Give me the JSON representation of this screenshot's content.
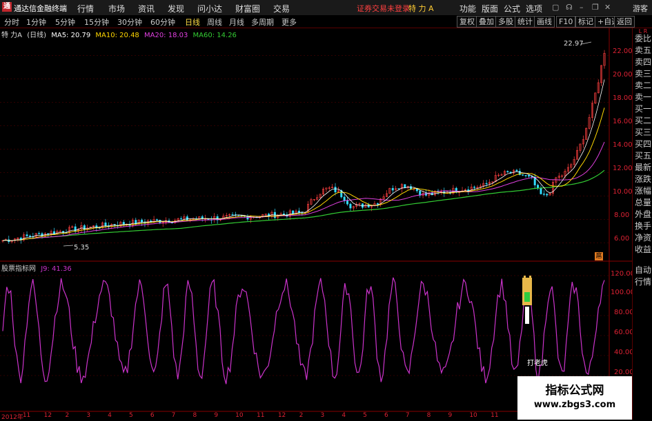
{
  "app": {
    "name": "通达信金融终端",
    "logo_text": "通"
  },
  "menu": [
    "行情",
    "市场",
    "资讯",
    "发现",
    "问小达",
    "财富圈",
    "交易"
  ],
  "login_status": "证券交易未登录",
  "stock_title": "特 力 A",
  "right_menu": [
    "功能",
    "版面",
    "公式",
    "选项"
  ],
  "guest": "游客",
  "period_tabs": [
    "分时",
    "1分钟",
    "5分钟",
    "15分钟",
    "30分钟",
    "60分钟",
    "日线",
    "周线",
    "月线",
    "多周期",
    "更多"
  ],
  "active_tab": "日线",
  "toolbar_buttons": [
    "复权",
    "叠加",
    "多股",
    "统计",
    "画线",
    "F10",
    "标记",
    "+自选",
    "返回"
  ],
  "main_chart": {
    "stock_label": "特 力A",
    "period_label": "(日线)",
    "ma": [
      {
        "label": "MA5: 20.79",
        "color": "#ffffff"
      },
      {
        "label": "MA10: 20.48",
        "color": "#ffd700"
      },
      {
        "label": "MA20: 18.03",
        "color": "#e040e0"
      },
      {
        "label": "MA60: 14.26",
        "color": "#33cc33"
      }
    ],
    "y_ticks": [
      "22.00",
      "20.00",
      "18.00",
      "16.00",
      "14.00",
      "12.00",
      "10.00",
      "8.00",
      "6.00"
    ],
    "high_label": "22.97",
    "low_label": "5.35",
    "badge": "扈"
  },
  "indicator": {
    "name": "股票指标网",
    "value_label": "J9: 41.36",
    "y_ticks": [
      "120.00",
      "100.00",
      "80.00",
      "60.00",
      "40.00",
      "20.00"
    ],
    "signal_label": "打老虎"
  },
  "right_panel": {
    "corner": "L R",
    "items": [
      "委比",
      "卖五",
      "卖四",
      "卖三",
      "卖二",
      "卖一",
      "买一",
      "买二",
      "买三",
      "买四",
      "买五",
      "最新",
      "涨跌",
      "涨幅",
      "总量",
      "外盘",
      "换手",
      "净资",
      "收益",
      "自动",
      "行情"
    ]
  },
  "date_axis": [
    "2012年",
    "11",
    "12",
    "2",
    "3",
    "4",
    "5",
    "6",
    "7",
    "8",
    "9",
    "10",
    "11",
    "12",
    "2",
    "3",
    "4",
    "5",
    "6",
    "7",
    "8",
    "9",
    "10",
    "11"
  ],
  "watermark": {
    "line1": "指标公式网",
    "line2": "www.zbgs3.com"
  },
  "colors": {
    "accent_red": "#dd2222",
    "indicator_line": "#cc33cc",
    "ma60": "#33cc33",
    "ma20": "#e040e0",
    "ma10": "#ffd700",
    "ma5": "#ffffff"
  }
}
